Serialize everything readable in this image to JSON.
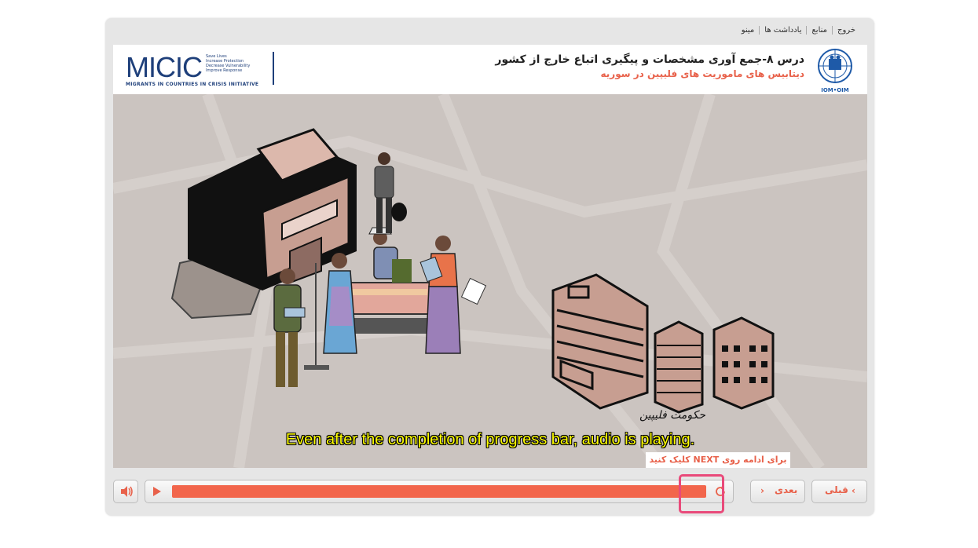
{
  "topnav": {
    "exit": "خروج",
    "resources": "منابع",
    "notes": "یادداشت ها",
    "menu": "مینو"
  },
  "header": {
    "micic_title": "MICIC",
    "micic_tagline": [
      "Save Lives",
      "Increase Protection",
      "Decrease Vulnerability",
      "Improve Response"
    ],
    "micic_subtitle": "MIGRANTS IN COUNTRIES IN CRISIS INITIATIVE",
    "lesson_title": "درس ۸-جمع آوری مشخصات و پیگیری اتباع خارج از کشور",
    "lesson_subtitle": "دیتابیس های ماموریت های فلیپین در سوریه",
    "iom_label": "IOM•OIM"
  },
  "stage": {
    "building_label": "حکومت فلیپین",
    "subtitle": "Even after the completion of progress bar, audio is playing.",
    "continue_hint": "برای ادامه روی NEXT کلیک کنید"
  },
  "controls": {
    "progress": 1.0,
    "next_label": "بعدی",
    "prev_label": "قبلی"
  },
  "colors": {
    "accent": "#f2664c",
    "subtitle": "#ffff00",
    "highlight": "#e94a7a",
    "brand_blue": "#1e3f7a"
  }
}
